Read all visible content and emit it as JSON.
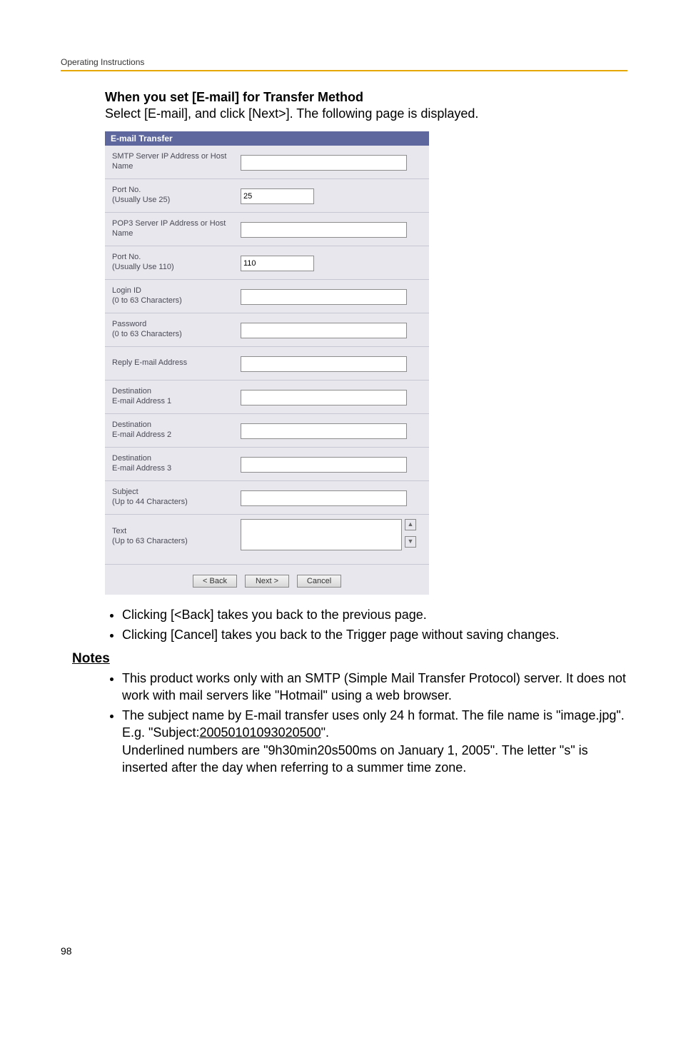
{
  "running_head": "Operating Instructions",
  "section": {
    "heading": "When you set [E-mail] for Transfer Method",
    "intro": "Select [E-mail], and click [Next>]. The following page is displayed."
  },
  "panel": {
    "title": "E-mail Transfer",
    "rows": [
      {
        "label": "SMTP Server IP Address or Host Name",
        "value": "",
        "short": false
      },
      {
        "label": "Port No.\n(Usually Use 25)",
        "value": "25",
        "short": true
      },
      {
        "label": "POP3 Server IP Address or Host Name",
        "value": "",
        "short": false
      },
      {
        "label": "Port No.\n(Usually Use 110)",
        "value": "110",
        "short": true
      },
      {
        "label": "Login ID\n(0 to 63 Characters)",
        "value": "",
        "short": false
      },
      {
        "label": "Password\n(0 to 63 Characters)",
        "value": "",
        "short": false
      },
      {
        "label": "Reply E-mail Address",
        "value": "",
        "short": false
      },
      {
        "label": "Destination\nE-mail Address 1",
        "value": "",
        "short": false
      },
      {
        "label": "Destination\nE-mail Address 2",
        "value": "",
        "short": false
      },
      {
        "label": "Destination\nE-mail Address 3",
        "value": "",
        "short": false
      },
      {
        "label": "Subject\n(Up to 44 Characters)",
        "value": "",
        "short": false
      },
      {
        "label": "Text\n(Up to 63 Characters)",
        "value": "",
        "textarea": true
      }
    ],
    "buttons": {
      "back": "< Back",
      "next": "Next >",
      "cancel": "Cancel"
    }
  },
  "after_bullets": [
    "Clicking [<Back] takes you back to the previous page.",
    "Clicking [Cancel] takes you back to the Trigger page without saving changes."
  ],
  "notes_heading": "Notes",
  "notes": [
    {
      "text_parts": [
        "This product works only with an SMTP (Simple Mail Transfer Protocol) server. It does not work with mail servers like \"Hotmail\" using a web browser."
      ]
    },
    {
      "text_parts": [
        "The subject name by E-mail transfer uses only 24 h format. The file name is \"image.jpg\".",
        "E.g. \"Subject:",
        "20050101093020500",
        "\".",
        "Underlined numbers are \"9h30min20s500ms on January 1, 2005\". The letter \"s\" is inserted after the day when referring to a summer time zone."
      ]
    }
  ],
  "page_number": "98"
}
